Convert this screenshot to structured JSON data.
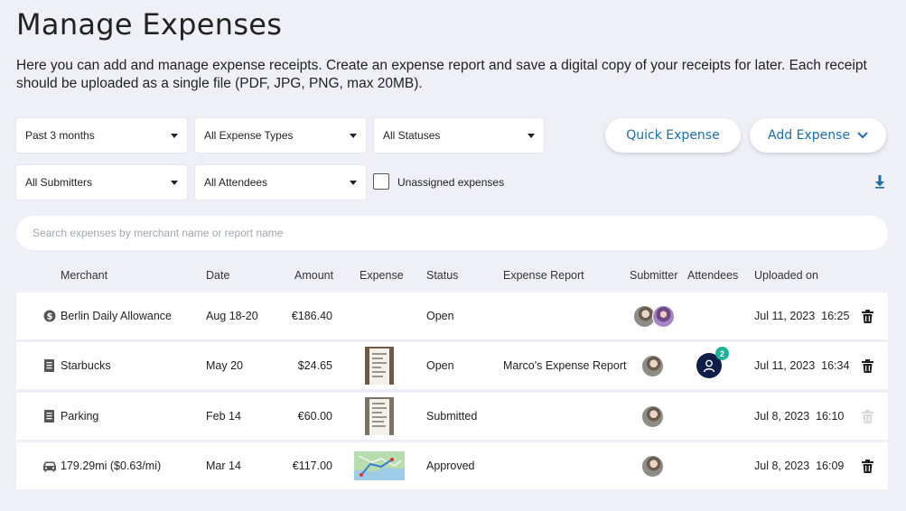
{
  "page": {
    "title": "Manage Expenses",
    "description": "Here you can add and manage expense receipts. Create an expense report and save a digital copy of your receipts for later. Each receipt should be uploaded as a single file (PDF, JPG, PNG, max 20MB)."
  },
  "filters": {
    "period": "Past 3 months",
    "expense_types": "All Expense Types",
    "statuses": "All Statuses",
    "submitters": "All Submitters",
    "attendees": "All Attendees",
    "unassigned_label": "Unassigned expenses",
    "unassigned_checked": false
  },
  "actions": {
    "quick_expense": "Quick Expense",
    "add_expense": "Add Expense"
  },
  "search": {
    "placeholder": "Search expenses by merchant name or report name"
  },
  "table": {
    "columns": {
      "merchant": "Merchant",
      "date": "Date",
      "amount": "Amount",
      "expense": "Expense",
      "status": "Status",
      "report": "Expense Report",
      "submitter": "Submitter",
      "attendees": "Attendees",
      "uploaded": "Uploaded on"
    },
    "rows": [
      {
        "icon": "dollar-circle-icon",
        "merchant": "Berlin Daily Allowance",
        "date": "Aug 18-20",
        "amount": "€186.40",
        "expense_thumb": "none",
        "status": "Open",
        "report": "",
        "submitters": [
          "avatar-a",
          "avatar-b"
        ],
        "attendee_count": "",
        "uploaded": "Jul 11, 2023  16:25",
        "delete_enabled": true
      },
      {
        "icon": "receipt-icon",
        "merchant": "Starbucks",
        "date": "May 20",
        "amount": "$24.65",
        "expense_thumb": "receipt",
        "status": "Open",
        "report": "Marco's Expense Report",
        "submitters": [
          "avatar-a"
        ],
        "attendee_count": "2",
        "uploaded": "Jul 11, 2023  16:34",
        "delete_enabled": true
      },
      {
        "icon": "receipt-icon",
        "merchant": "Parking",
        "date": "Feb 14",
        "amount": "€60.00",
        "expense_thumb": "receipt",
        "status": "Submitted",
        "report": "",
        "submitters": [
          "avatar-a"
        ],
        "attendee_count": "",
        "uploaded": "Jul 8, 2023  16:10",
        "delete_enabled": false
      },
      {
        "icon": "car-icon",
        "merchant": "179.29mi ($0.63/mi)",
        "date": "Mar 14",
        "amount": "€117.00",
        "expense_thumb": "map",
        "status": "Approved",
        "report": "",
        "submitters": [
          "avatar-a"
        ],
        "attendee_count": "",
        "uploaded": "Jul 8, 2023  16:09",
        "delete_enabled": true
      }
    ]
  },
  "colors": {
    "background": "#eff0f7",
    "accent": "#1c6da9",
    "badge": "#20b39a",
    "attendee_avatar": "#0e1d4a"
  }
}
